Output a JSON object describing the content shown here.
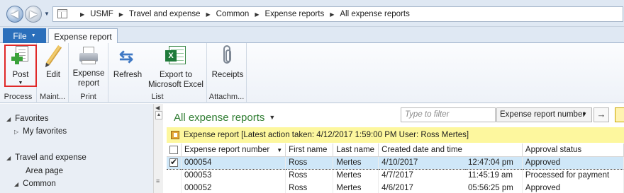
{
  "address_bar": {
    "breadcrumbs": [
      "USMF",
      "Travel and expense",
      "Common",
      "Expense reports",
      "All expense reports"
    ]
  },
  "tabs": {
    "file": "File",
    "expense_report": "Expense report"
  },
  "ribbon": {
    "groups": [
      {
        "label": "Process",
        "buttons": [
          {
            "label": "Post",
            "icon": "post-icon"
          }
        ]
      },
      {
        "label": "Maint...",
        "buttons": [
          {
            "label": "Edit",
            "icon": "pencil-icon"
          }
        ]
      },
      {
        "label": "Print",
        "buttons": [
          {
            "label": "Expense\nreport",
            "icon": "printer-icon"
          }
        ]
      },
      {
        "label": "List",
        "buttons": [
          {
            "label": "Refresh",
            "icon": "refresh-icon"
          },
          {
            "label": "Export to\nMicrosoft Excel",
            "icon": "excel-icon"
          }
        ]
      },
      {
        "label": "Attachm...",
        "buttons": [
          {
            "label": "Receipts",
            "icon": "paperclip-icon"
          }
        ]
      }
    ]
  },
  "nav": {
    "items": [
      "Favorites",
      "My favorites",
      "Travel and expense",
      "Area page",
      "Common"
    ]
  },
  "main": {
    "title": "All expense reports",
    "filter_placeholder": "Type to filter",
    "filter_field": "Expense report number",
    "info": "Expense report  [Latest action taken: 4/12/2017 1:59:00 PM  User: Ross Mertes]",
    "columns": [
      "Expense report number",
      "First name",
      "Last name",
      "Created date and time",
      "",
      "Approval status"
    ],
    "rows": [
      {
        "checked": true,
        "cells": [
          "000054",
          "Ross",
          "Mertes",
          "4/10/2017",
          "12:47:04 pm",
          "Approved"
        ]
      },
      {
        "checked": false,
        "cells": [
          "000053",
          "Ross",
          "Mertes",
          "4/7/2017",
          "11:45:19 am",
          "Processed for payment"
        ]
      },
      {
        "checked": false,
        "cells": [
          "000052",
          "Ross",
          "Mertes",
          "4/6/2017",
          "05:56:25 pm",
          "Approved"
        ]
      }
    ]
  },
  "colors": {
    "accent_blue": "#2b6fbb",
    "title_green": "#2f7d32",
    "info_yellow": "#fdf79e",
    "selected_row": "#cfe7f8",
    "highlight_red": "#e02828"
  }
}
